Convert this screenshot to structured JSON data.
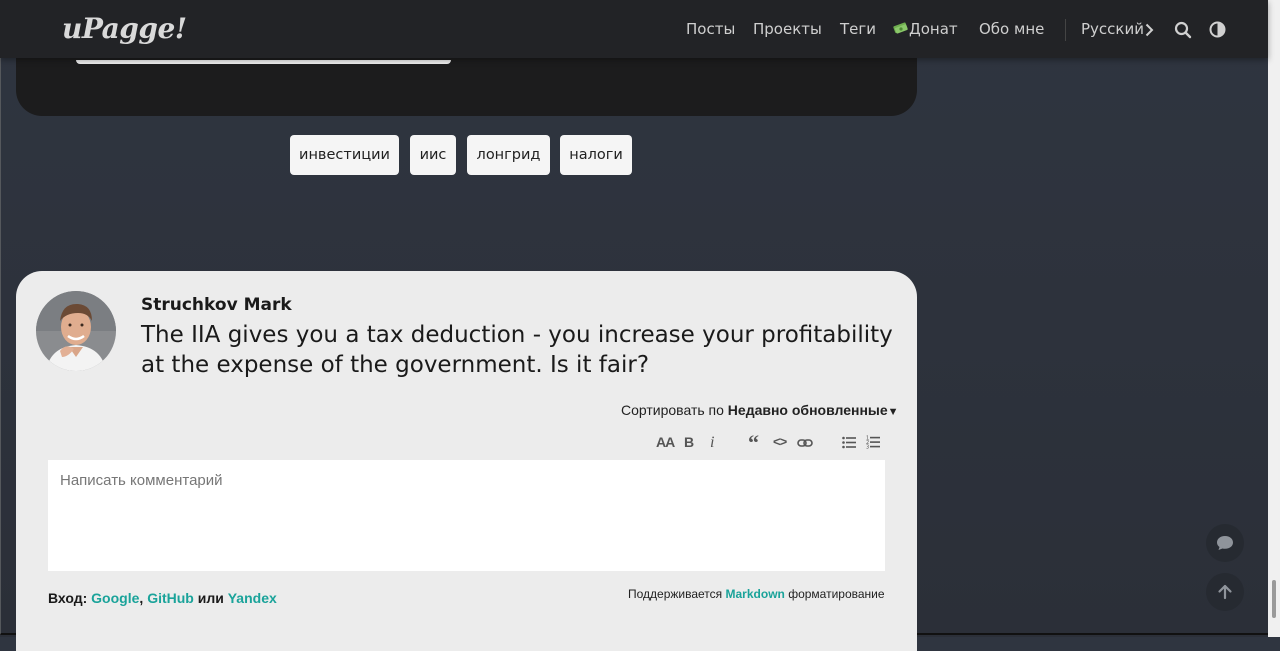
{
  "header": {
    "logo": "uPagge!",
    "nav": {
      "posts": "Посты",
      "projects": "Проекты",
      "tags": "Теги",
      "donate": "Донат",
      "about": "Обо мне",
      "language": "Русский"
    },
    "icons": [
      "chevron-right-icon",
      "search-icon",
      "theme-toggle-icon",
      "money-icon"
    ]
  },
  "tags": [
    "инвестиции",
    "иис",
    "лонгрид",
    "налоги"
  ],
  "comment_card": {
    "author": "Struchkov Mark",
    "quote": "The IIA gives you a tax deduction - you increase your profitability at the expense of the government. Is it fair?",
    "sort": {
      "prefix": "Сортировать по",
      "value": "Недавно обновленные"
    },
    "toolbar": {
      "font_size": "AA",
      "bold": "B",
      "italic": "i",
      "quote": "“",
      "code": "<>",
      "icons": [
        "link-icon",
        "bulleted-list-icon",
        "numbered-list-icon"
      ]
    },
    "editor": {
      "placeholder": "Написать комментарий",
      "value": ""
    },
    "login": {
      "label": "Вход:",
      "google": "Google",
      "github": "GitHub",
      "or": "или",
      "yandex": "Yandex"
    },
    "markdown": {
      "prefix": "Поддерживается",
      "link": "Markdown",
      "suffix": "форматирование"
    }
  },
  "floating": {
    "icons": [
      "comment-icon",
      "arrow-up-icon"
    ]
  },
  "colors": {
    "accent": "#1aa39a",
    "header_bg": "#222326",
    "page_bg": "#2f3540",
    "card_bg": "#ececec"
  }
}
